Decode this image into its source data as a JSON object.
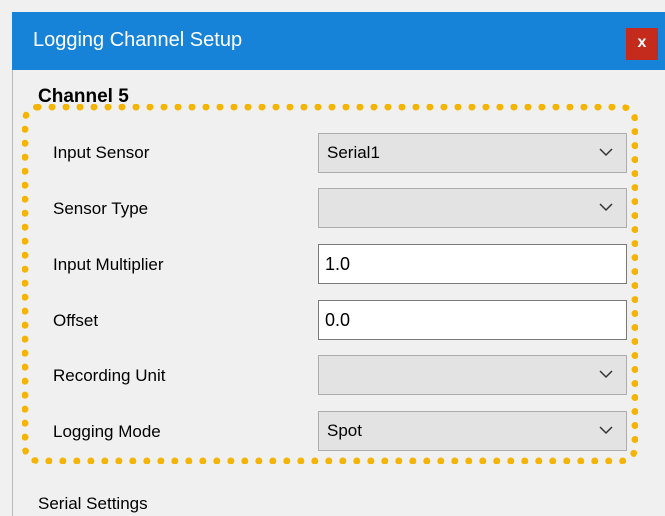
{
  "window": {
    "title": "Logging Channel Setup",
    "close_label": "x"
  },
  "channel": {
    "title": "Channel 5"
  },
  "fields": {
    "input_sensor": {
      "label": "Input Sensor",
      "value": "Serial1"
    },
    "sensor_type": {
      "label": "Sensor Type",
      "value": ""
    },
    "input_multiplier": {
      "label": "Input Multiplier",
      "value": "1.0"
    },
    "offset": {
      "label": "Offset",
      "value": "0.0"
    },
    "recording_unit": {
      "label": "Recording Unit",
      "value": ""
    },
    "logging_mode": {
      "label": "Logging Mode",
      "value": "Spot"
    }
  },
  "serial_settings": {
    "label": "Serial Settings"
  },
  "colors": {
    "title_bar": "#1683d8",
    "close_button": "#c42b1c",
    "highlight_frame": "#f5b400",
    "dialog_background": "#f0f0f0"
  },
  "icons": {
    "dropdown": "chevron-down-icon",
    "close": "close-icon"
  }
}
